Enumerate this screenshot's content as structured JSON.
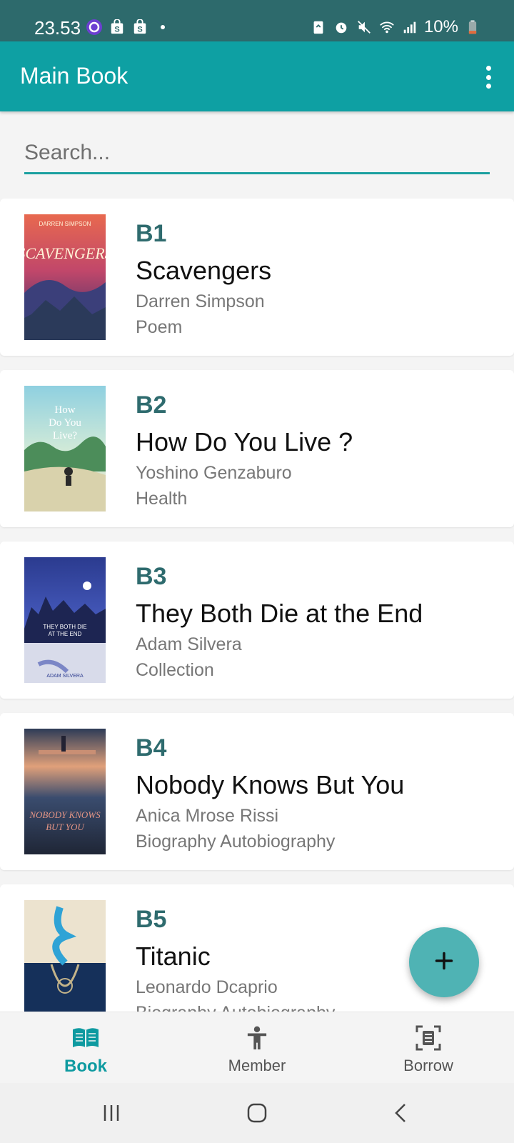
{
  "status_bar": {
    "time": "23.53",
    "battery": "10%"
  },
  "app_bar": {
    "title": "Main Book"
  },
  "search": {
    "placeholder": "Search...",
    "value": ""
  },
  "books": [
    {
      "code": "B1",
      "title": "Scavengers",
      "author": "Darren Simpson",
      "genre": "Poem"
    },
    {
      "code": "B2",
      "title": "How Do You Live ?",
      "author": "Yoshino Genzaburo",
      "genre": "Health"
    },
    {
      "code": "B3",
      "title": "They Both Die at the End",
      "author": "Adam Silvera",
      "genre": "Collection"
    },
    {
      "code": "B4",
      "title": "Nobody Knows But You",
      "author": "Anica Mrose Rissi",
      "genre": "Biography Autobiography"
    },
    {
      "code": "B5",
      "title": "Titanic",
      "author": "Leonardo Dcaprio",
      "genre": "Biography Autobiography"
    }
  ],
  "bottom_nav": {
    "items": [
      {
        "label": "Book",
        "icon": "book-open-icon",
        "active": true
      },
      {
        "label": "Member",
        "icon": "person-icon",
        "active": false
      },
      {
        "label": "Borrow",
        "icon": "document-scan-icon",
        "active": false
      }
    ]
  },
  "colors": {
    "status_bar": "#2d6a6c",
    "app_bar": "#0ea0a3",
    "accent": "#0e9aa0",
    "code_text": "#2e6b6e",
    "fab": "#4fb3b4"
  }
}
